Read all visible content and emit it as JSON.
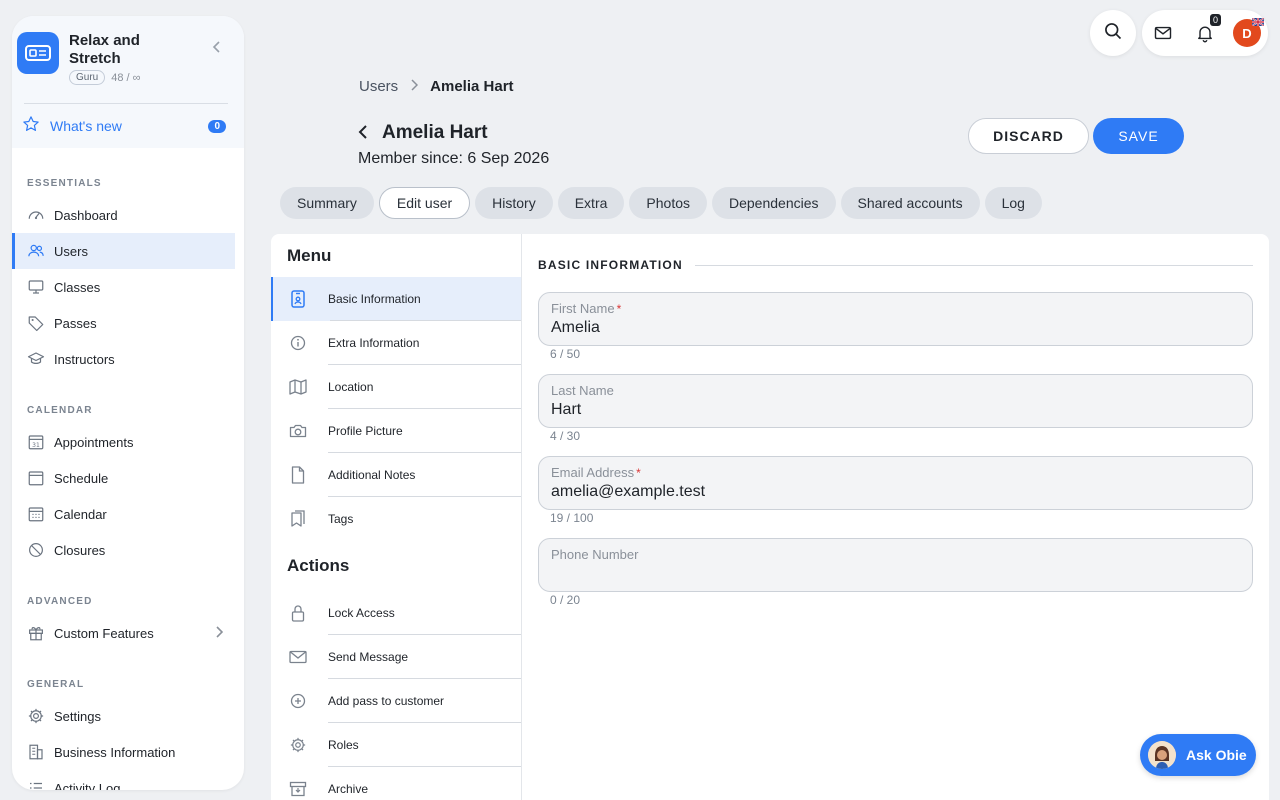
{
  "sidebar": {
    "brand_name": "Relax and Stretch",
    "tier_badge": "Guru",
    "usage": "48 / ∞",
    "whats_new": {
      "label": "What's new",
      "count": "0"
    },
    "sections": [
      {
        "heading": "ESSENTIALS",
        "items": [
          {
            "label": "Dashboard",
            "icon": "dashboard-icon"
          },
          {
            "label": "Users",
            "icon": "users-icon",
            "active": true
          },
          {
            "label": "Classes",
            "icon": "classes-icon"
          },
          {
            "label": "Passes",
            "icon": "tag-icon"
          },
          {
            "label": "Instructors",
            "icon": "graduation-cap-icon"
          }
        ]
      },
      {
        "heading": "CALENDAR",
        "items": [
          {
            "label": "Appointments",
            "icon": "calendar-31-icon"
          },
          {
            "label": "Schedule",
            "icon": "schedule-icon"
          },
          {
            "label": "Calendar",
            "icon": "calendar-grid-icon"
          },
          {
            "label": "Closures",
            "icon": "blocked-icon"
          }
        ]
      },
      {
        "heading": "ADVANCED",
        "items": [
          {
            "label": "Custom Features",
            "icon": "gift-icon"
          }
        ]
      },
      {
        "heading": "GENERAL",
        "items": [
          {
            "label": "Settings",
            "icon": "gear-icon"
          },
          {
            "label": "Business Information",
            "icon": "building-icon"
          },
          {
            "label": "Activity Log",
            "icon": "list-icon"
          }
        ]
      }
    ]
  },
  "topbar": {
    "notification_count": "0",
    "avatar_initial": "D"
  },
  "breadcrumb": {
    "parent": "Users",
    "current": "Amelia Hart"
  },
  "header": {
    "title": "Amelia Hart",
    "subtitle": "Member since: 6 Sep 2026",
    "discard_label": "DISCARD",
    "save_label": "SAVE"
  },
  "tabs": [
    "Summary",
    "Edit user",
    "History",
    "Extra",
    "Photos",
    "Dependencies",
    "Shared accounts",
    "Log"
  ],
  "active_tab": "Edit user",
  "menu": {
    "heading": "Menu",
    "items": [
      "Basic Information",
      "Extra Information",
      "Location",
      "Profile Picture",
      "Additional Notes",
      "Tags"
    ],
    "actions_heading": "Actions",
    "actions": [
      "Lock Access",
      "Send Message",
      "Add pass to customer",
      "Roles",
      "Archive"
    ]
  },
  "form": {
    "section_title": "BASIC INFORMATION",
    "fields": [
      {
        "label": "First Name",
        "required": true,
        "value": "Amelia",
        "counter": "6 / 50"
      },
      {
        "label": "Last Name",
        "required": false,
        "value": "Hart",
        "counter": "4 / 30"
      },
      {
        "label": "Email Address",
        "required": true,
        "value": "amelia@example.test",
        "counter": "19 / 100"
      },
      {
        "label": "Phone Number",
        "required": false,
        "value": "",
        "counter": "0 / 20"
      }
    ]
  },
  "assistant": {
    "label": "Ask Obie"
  },
  "colors": {
    "accent": "#2f7bf5",
    "avatar": "#e2491d",
    "required": "#d93636"
  }
}
